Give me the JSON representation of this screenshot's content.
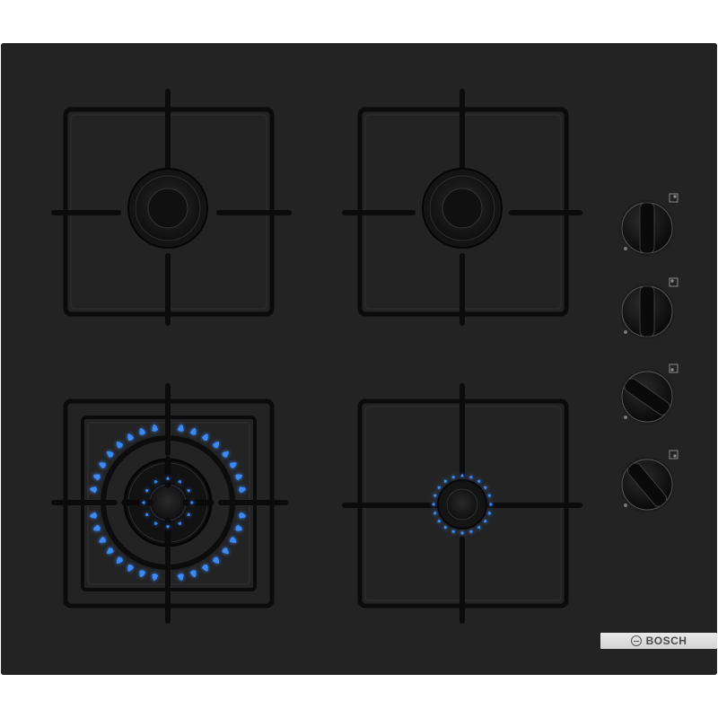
{
  "appliance": {
    "type": "gas hob",
    "surface_color": "#232323",
    "flame_color": "#3a8cff"
  },
  "brand": {
    "label": "BOSCH"
  },
  "burners": [
    {
      "id": "rear-left",
      "lit": false,
      "size": "medium"
    },
    {
      "id": "rear-right",
      "lit": false,
      "size": "medium"
    },
    {
      "id": "front-left",
      "lit": true,
      "size": "wok"
    },
    {
      "id": "front-right",
      "lit": true,
      "size": "small"
    }
  ],
  "knobs": [
    {
      "controls": "rear-right"
    },
    {
      "controls": "rear-left"
    },
    {
      "controls": "front-left"
    },
    {
      "controls": "front-right"
    }
  ]
}
